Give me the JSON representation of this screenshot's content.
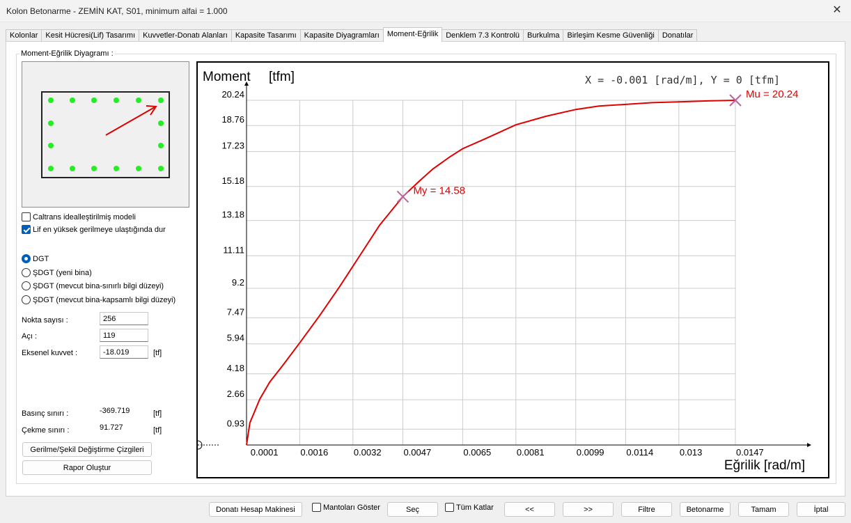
{
  "window": {
    "title": "Kolon Betonarme - ZEMİN KAT, S01, minimum alfai = 1.000",
    "close_glyph": "✕"
  },
  "tabs": [
    {
      "label": "Kolonlar",
      "active": false
    },
    {
      "label": "Kesit Hücresi(Lif) Tasarımı",
      "active": false
    },
    {
      "label": "Kuvvetler-Donatı Alanları",
      "active": false
    },
    {
      "label": "Kapasite Tasarımı",
      "active": false
    },
    {
      "label": "Kapasite Diyagramları",
      "active": false
    },
    {
      "label": "Moment-Eğrilik",
      "active": true
    },
    {
      "label": "Denklem 7.3 Kontrolü",
      "active": false
    },
    {
      "label": "Burkulma",
      "active": false
    },
    {
      "label": "Birleşim Kesme Güvenliği",
      "active": false
    },
    {
      "label": "Donatılar",
      "active": false
    }
  ],
  "panel": {
    "group_label": "Moment-Eğrilik Diyagramı :",
    "caltrans_label": "Caltrans idealleştirilmiş modeli",
    "caltrans_checked": false,
    "lif_label": "Lif en yüksek gerilmeye ulaştığında dur",
    "lif_checked": true,
    "radios": [
      {
        "label": "DGT",
        "checked": true
      },
      {
        "label": "ŞDGT (yeni bina)",
        "checked": false
      },
      {
        "label": "ŞDGT (mevcut bina-sınırlı bilgi düzeyi)",
        "checked": false
      },
      {
        "label": "ŞDGT (mevcut bina-kapsamlı bilgi düzeyi)",
        "checked": false
      }
    ],
    "nokta_label": "Nokta sayısı :",
    "nokta_value": "256",
    "aci_label": "Açı :",
    "aci_value": "119",
    "eksenel_label": "Eksenel kuvvet :",
    "eksenel_value": "-18.019",
    "eksenel_unit": "[tf]",
    "basinc_label": "Basınç sınırı :",
    "basinc_value": "-369.719",
    "basinc_unit": "[tf]",
    "cekme_label": "Çekme sınırı :",
    "cekme_value": "91.727",
    "cekme_unit": "[tf]",
    "gerilme_button": "Gerilme/Şekil Değiştirme Çizgileri",
    "rapor_button": "Rapor Oluştur",
    "section_bar_color": "#22ee22",
    "arrow_color": "#dd0000"
  },
  "chart_data": {
    "type": "line",
    "ylabel": "Moment",
    "yunit": "[tfm]",
    "xlabel": "Eğrilik [rad/m]",
    "readout": "X = -0.001 [rad/m],  Y = 0 [tfm]",
    "x_ticks": [
      "0.0001",
      "0.0016",
      "0.0032",
      "0.0047",
      "0.0065",
      "0.0081",
      "0.0099",
      "0.0114",
      "0.013",
      "0.0147"
    ],
    "y_ticks": [
      "0.93",
      "2.66",
      "4.18",
      "5.94",
      "7.47",
      "9.2",
      "11.11",
      "13.18",
      "15.18",
      "17.23",
      "18.76",
      "20.24"
    ],
    "xlim": [
      0.0,
      0.0147
    ],
    "ylim": [
      0.0,
      20.24
    ],
    "grid": true,
    "series": [
      {
        "color": "#e00000",
        "x": [
          0.0,
          0.0001,
          0.0004,
          0.0007,
          0.0011,
          0.0016,
          0.0022,
          0.0028,
          0.0034,
          0.004,
          0.0047,
          0.0052,
          0.0056,
          0.0061,
          0.0065,
          0.0072,
          0.0081,
          0.009,
          0.0099,
          0.0106,
          0.0114,
          0.0122,
          0.013,
          0.0138,
          0.0147
        ],
        "y": [
          0.0,
          1.3,
          2.7,
          3.7,
          4.7,
          6.0,
          7.6,
          9.3,
          11.1,
          12.9,
          14.58,
          15.5,
          16.2,
          16.9,
          17.4,
          18.0,
          18.8,
          19.3,
          19.7,
          19.9,
          20.0,
          20.1,
          20.15,
          20.2,
          20.24
        ]
      }
    ],
    "annotations": [
      {
        "label": "My = 14.58",
        "x": 0.0047,
        "y": 14.58,
        "marker_color": "#c060a0",
        "text_color": "#e00000"
      },
      {
        "label": "Mu = 20.24",
        "x": 0.0147,
        "y": 20.24,
        "marker_color": "#c060a0",
        "text_color": "#e00000"
      }
    ]
  },
  "bottom": {
    "donati_button": "Donatı Hesap Makinesi",
    "mantolari_label": "Mantoları Göster",
    "mantolari_checked": false,
    "sec_button": "Seç",
    "tumkatlar_label": "Tüm Katlar",
    "tumkatlar_checked": false,
    "prev_button": "<<",
    "next_button": ">>",
    "filtre_button": "Filtre",
    "betonarme_button": "Betonarme",
    "tamam_button": "Tamam",
    "iptal_button": "İptal"
  }
}
